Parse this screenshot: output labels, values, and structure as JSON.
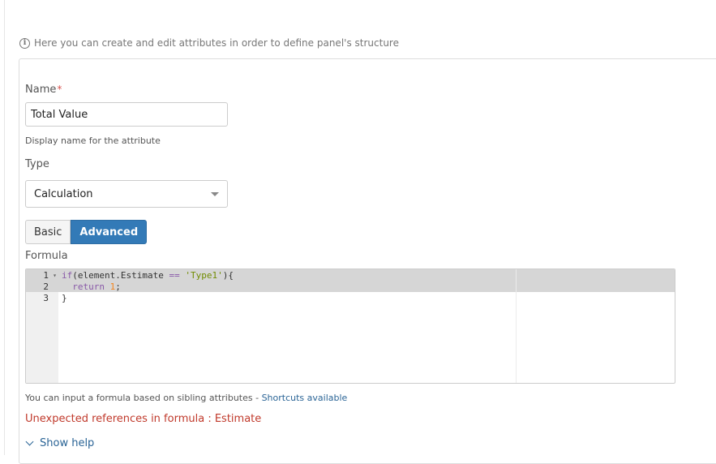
{
  "info": {
    "icon": "info-icon",
    "text": "Here you can create and edit attributes in order to define panel's structure"
  },
  "form": {
    "name_label": "Name",
    "name_required_mark": "*",
    "name_value": "Total Value",
    "name_hint": "Display name for the attribute",
    "type_label": "Type",
    "type_selected": "Calculation",
    "mode_tabs": [
      {
        "label": "Basic",
        "active": false
      },
      {
        "label": "Advanced",
        "active": true
      }
    ],
    "formula_label": "Formula",
    "formula_hint": "You can input a formula based on sibling attributes - ",
    "shortcuts_link": "Shortcuts available",
    "error_text": "Unexpected references in formula : Estimate",
    "show_help": "Show help"
  },
  "editor": {
    "line_numbers": [
      "1",
      "2",
      "3"
    ],
    "lines": [
      {
        "kw": "if",
        "rest1": "(element.Estimate ",
        "op": "==",
        "rest2": " ",
        "str": "'Type1'",
        "rest3": "){"
      },
      {
        "indent": "  ",
        "kw": "return",
        "rest1": " ",
        "num": "1",
        "rest2": ";"
      },
      {
        "text": "}"
      }
    ]
  },
  "colors": {
    "primary": "#337ab7",
    "error": "#c0392b",
    "link": "#2a6496"
  }
}
